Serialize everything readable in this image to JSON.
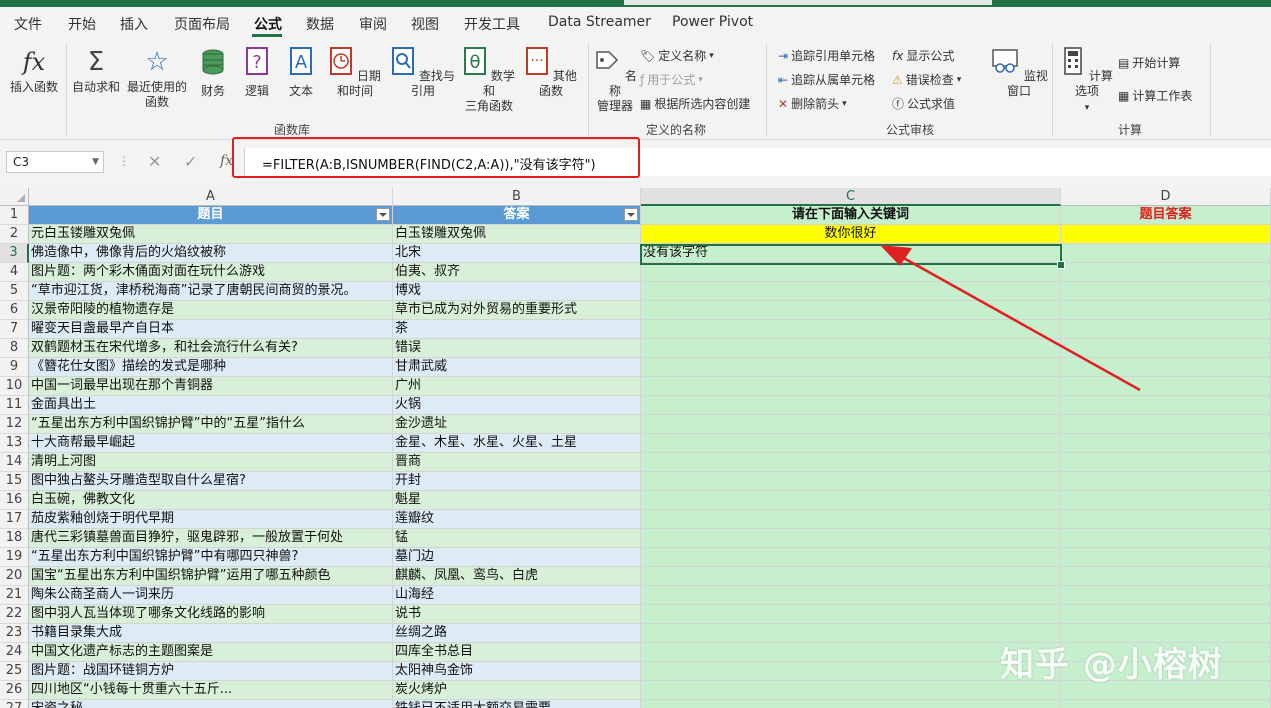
{
  "tabs": [
    "文件",
    "开始",
    "插入",
    "页面布局",
    "公式",
    "数据",
    "审阅",
    "视图",
    "开发工具",
    "Data Streamer",
    "Power Pivot"
  ],
  "active_tab": "公式",
  "ribbon": {
    "insert_function": "插入函数",
    "autosum": "自动求和",
    "recent_1": "最近使用的",
    "recent_2": "函数",
    "financial": "财务",
    "logical": "逻辑",
    "text": "文本",
    "datetime": "日期和时间",
    "lookup": "查找与引用",
    "math_1": "数学和",
    "math_2": "三角函数",
    "more": "其他函数",
    "group_library": "函数库",
    "name_mgr_1": "名称",
    "name_mgr_2": "管理器",
    "define_name": "定义名称",
    "use_in_formula": "用于公式",
    "create_from_sel": "根据所选内容创建",
    "group_names": "定义的名称",
    "trace_precedents": "追踪引用单元格",
    "trace_dependents": "追踪从属单元格",
    "remove_arrows": "删除箭头",
    "show_formulas": "显示公式",
    "error_check": "错误检查",
    "evaluate": "公式求值",
    "watch_window": "监视窗口",
    "group_audit": "公式审核",
    "calc_options": "计算选项",
    "calc_now": "开始计算",
    "calc_sheet": "计算工作表",
    "group_calc": "计算"
  },
  "formula_bar": {
    "name_box": "C3",
    "formula": "=FILTER(A:B,ISNUMBER(FIND(C2,A:A)),\"没有该字符\")",
    "fx": "fx"
  },
  "columns": [
    "A",
    "B",
    "C",
    "D"
  ],
  "header_row": {
    "a": "题目",
    "b": "答案",
    "c": "请在下面输入关键词",
    "d": "题目答案"
  },
  "keyword": "数你很好",
  "result": "没有该字符",
  "rows": [
    {
      "n": "2",
      "a": "元白玉镂雕双兔佩",
      "b": "白玉镂雕双兔佩"
    },
    {
      "n": "3",
      "a": "佛造像中，佛像背后的火焰纹被称",
      "b": "北宋"
    },
    {
      "n": "4",
      "a": "图片题：两个彩木俑面对面在玩什么游戏",
      "b": "伯夷、叔齐"
    },
    {
      "n": "5",
      "a": "“草市迎江货，津桥税海商”记录了唐朝民间商贸的景况。",
      "b": "博戏"
    },
    {
      "n": "6",
      "a": "汉景帝阳陵的植物遗存是",
      "b": "草市已成为对外贸易的重要形式"
    },
    {
      "n": "7",
      "a": "曜变天目盏最早产自日本",
      "b": "茶"
    },
    {
      "n": "8",
      "a": "双鹤题材玉在宋代增多，和社会流行什么有关?",
      "b": "错误"
    },
    {
      "n": "9",
      "a": "《簪花仕女图》描绘的发式是哪种",
      "b": "甘肃武威"
    },
    {
      "n": "10",
      "a": "中国一词最早出现在那个青铜器",
      "b": "广州"
    },
    {
      "n": "11",
      "a": "金面具出土",
      "b": "火锅"
    },
    {
      "n": "12",
      "a": "“五星出东方利中国织锦护臂”中的“五星”指什么",
      "b": "金沙遗址"
    },
    {
      "n": "13",
      "a": "十大商帮最早崛起",
      "b": "金星、木星、水星、火星、土星"
    },
    {
      "n": "14",
      "a": "清明上河图",
      "b": "晋商"
    },
    {
      "n": "15",
      "a": "图中独占鳌头牙雕造型取自什么星宿?",
      "b": "开封"
    },
    {
      "n": "16",
      "a": "白玉碗，佛教文化",
      "b": "魁星"
    },
    {
      "n": "17",
      "a": "茄皮紫釉创烧于明代早期",
      "b": "莲瓣纹"
    },
    {
      "n": "18",
      "a": "唐代三彩镇墓兽面目狰狞，驱鬼辟邪，一般放置于何处",
      "b": "锰"
    },
    {
      "n": "19",
      "a": "“五星出东方利中国织锦护臂”中有哪四只神兽?",
      "b": "墓门边"
    },
    {
      "n": "20",
      "a": "国宝“五星出东方利中国织锦护臂”运用了哪五种颜色",
      "b": "麒麟、凤凰、鸾鸟、白虎"
    },
    {
      "n": "21",
      "a": "陶朱公商圣商人一词来历",
      "b": "山海经"
    },
    {
      "n": "22",
      "a": "图中羽人瓦当体现了哪条文化线路的影响",
      "b": "说书"
    },
    {
      "n": "23",
      "a": "书籍目录集大成",
      "b": "丝绸之路"
    },
    {
      "n": "24",
      "a": "中国文化遗产标志的主题图案是",
      "b": "四库全书总目"
    },
    {
      "n": "25",
      "a": "图片题：战国环链铜方炉",
      "b": "太阳神鸟金饰"
    },
    {
      "n": "26",
      "a": "四川地区“小钱每十贯重六十五斤...",
      "b": "炭火烤炉"
    },
    {
      "n": "27",
      "a": "宋瓷之秘",
      "b": "铁钱已不适用大额交易需要"
    }
  ],
  "watermark": "知乎 @小榕树"
}
